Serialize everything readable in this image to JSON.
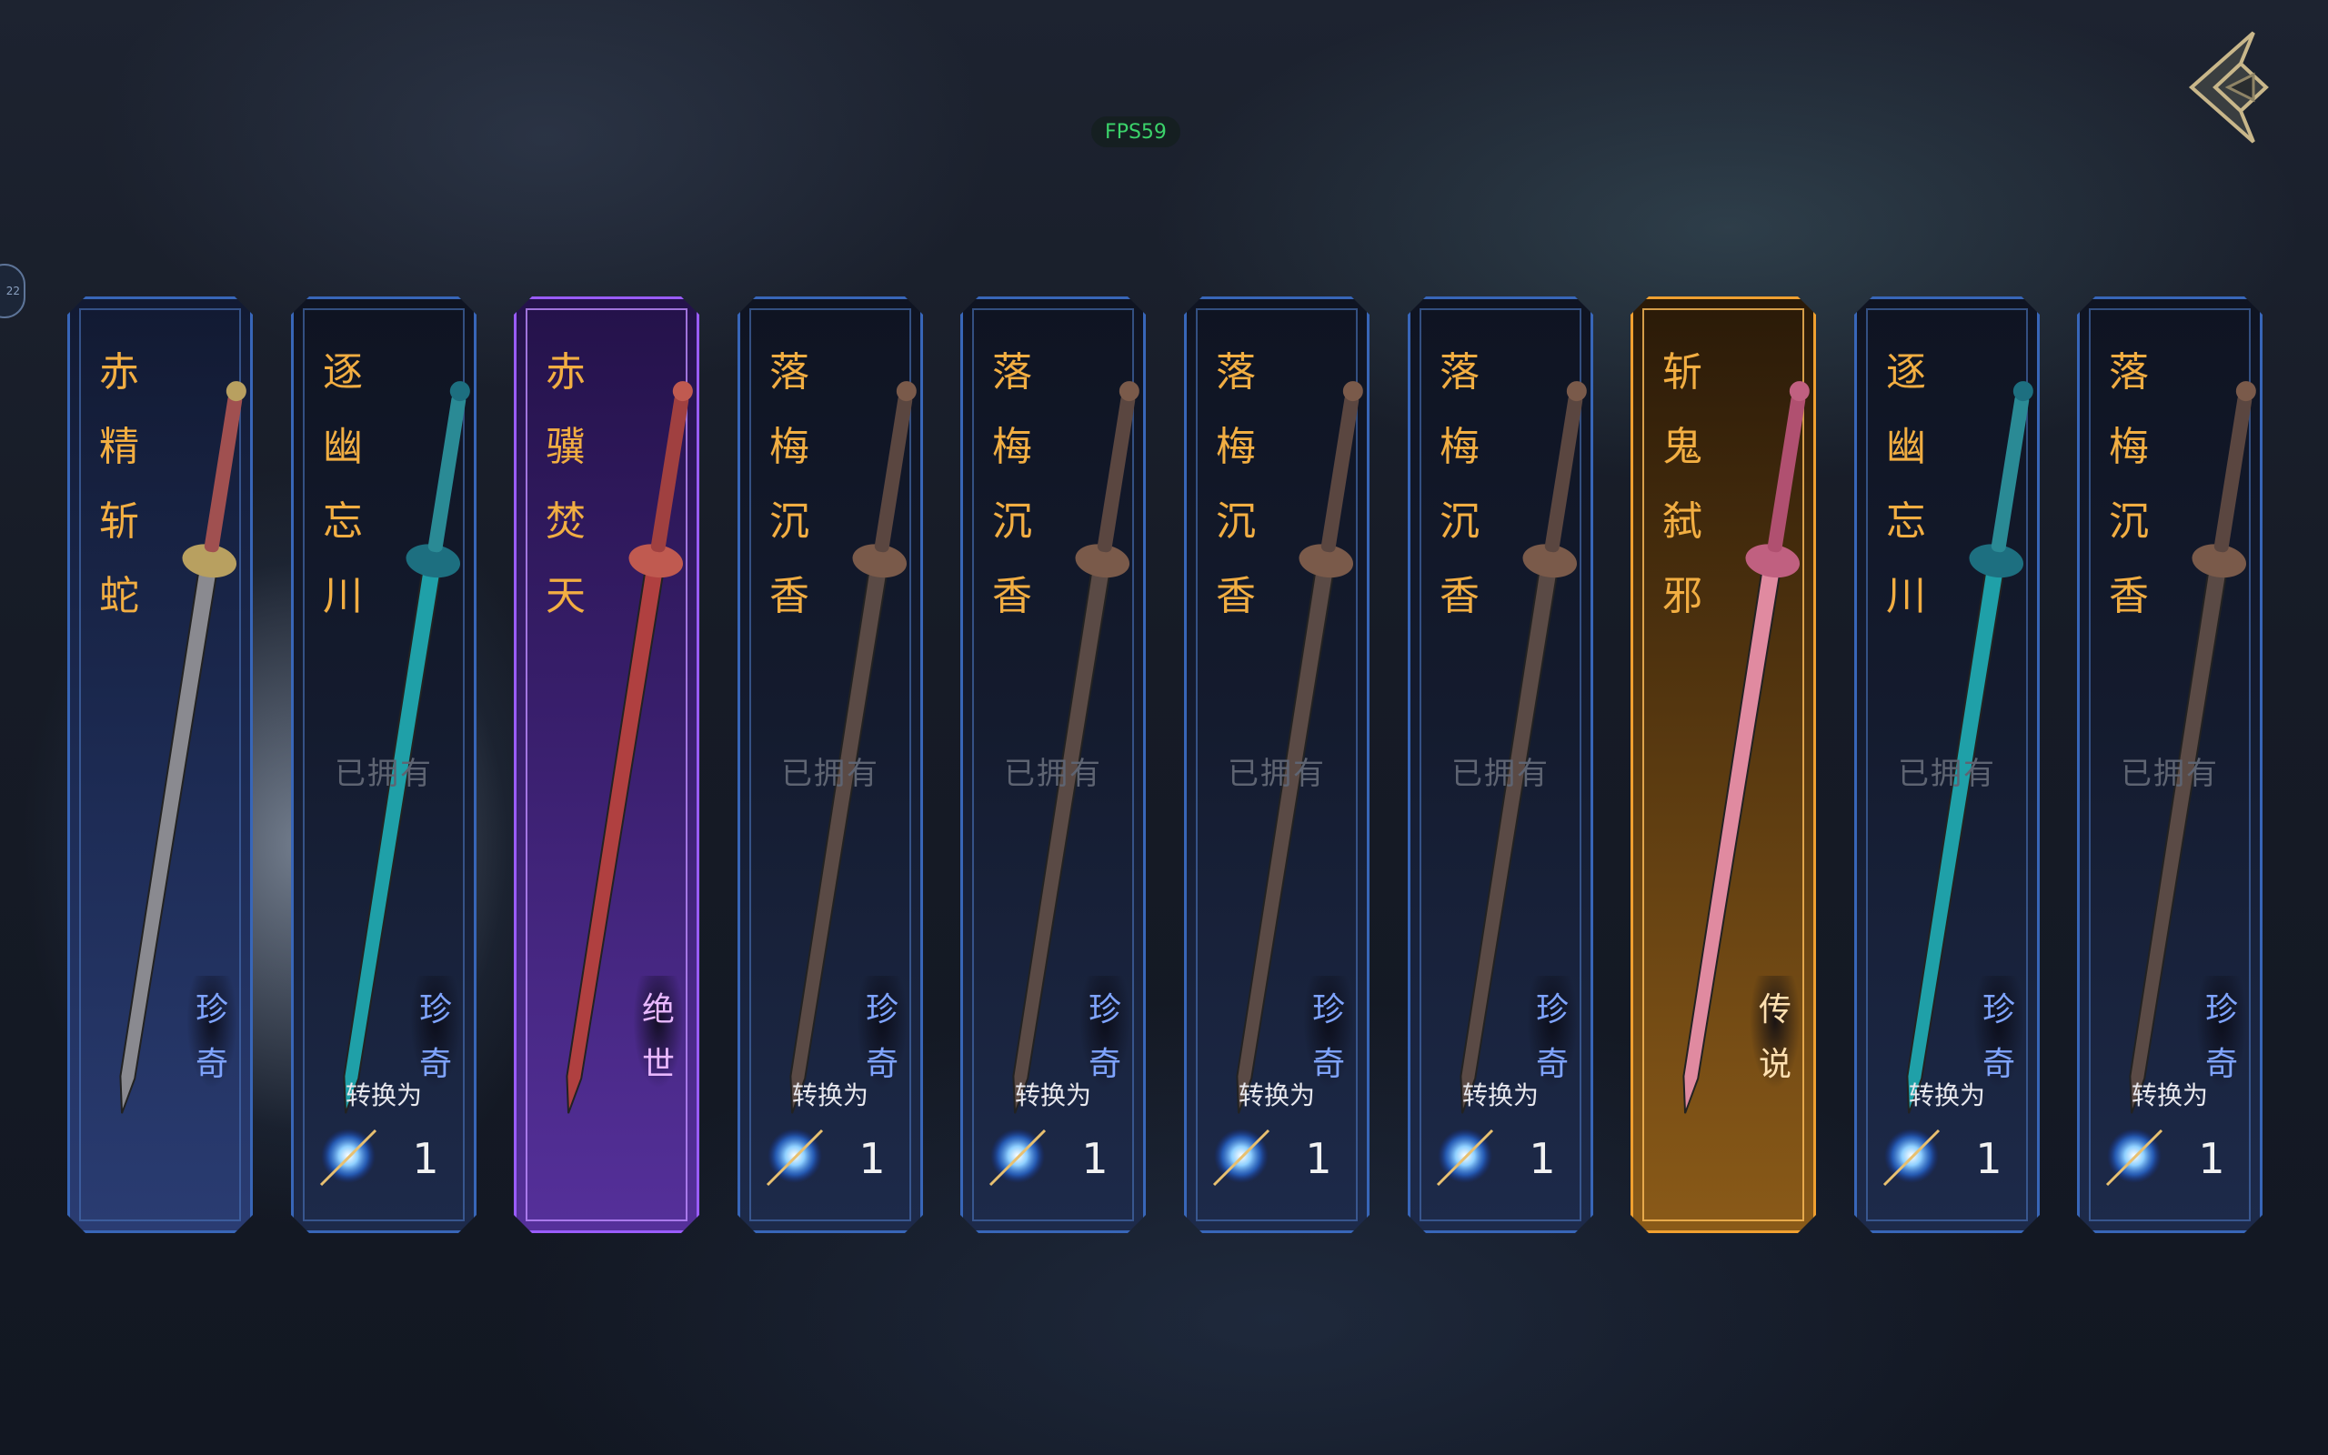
{
  "hud": {
    "fps": "FPS59",
    "side_tab": "22"
  },
  "cards": [
    {
      "name": "赤精斩蛇",
      "rarity": "珍奇",
      "rarity_level": "rare",
      "owned_label": "",
      "convert_label": "",
      "quantity": "",
      "blade": "#8a8a90",
      "hilt": "#b8a060",
      "grip": "#a05050"
    },
    {
      "name": "逐幽忘川",
      "rarity": "珍奇",
      "rarity_level": "rare",
      "owned_label": "已拥有",
      "convert_label": "转换为",
      "quantity": "1",
      "blade": "#1fa0a8",
      "hilt": "#1d6f80",
      "grip": "#2a8a95"
    },
    {
      "name": "赤骥焚天",
      "rarity": "绝世",
      "rarity_level": "epic",
      "owned_label": "",
      "convert_label": "",
      "quantity": "",
      "blade": "#b04040",
      "hilt": "#c05a50",
      "grip": "#a04040"
    },
    {
      "name": "落梅沉香",
      "rarity": "珍奇",
      "rarity_level": "rare",
      "owned_label": "已拥有",
      "convert_label": "转换为",
      "quantity": "1",
      "blade": "#5a4a45",
      "hilt": "#7a5a4a",
      "grip": "#5a4640"
    },
    {
      "name": "落梅沉香",
      "rarity": "珍奇",
      "rarity_level": "rare",
      "owned_label": "已拥有",
      "convert_label": "转换为",
      "quantity": "1",
      "blade": "#5a4a45",
      "hilt": "#7a5a4a",
      "grip": "#5a4640"
    },
    {
      "name": "落梅沉香",
      "rarity": "珍奇",
      "rarity_level": "rare",
      "owned_label": "已拥有",
      "convert_label": "转换为",
      "quantity": "1",
      "blade": "#5a4a45",
      "hilt": "#7a5a4a",
      "grip": "#5a4640"
    },
    {
      "name": "落梅沉香",
      "rarity": "珍奇",
      "rarity_level": "rare",
      "owned_label": "已拥有",
      "convert_label": "转换为",
      "quantity": "1",
      "blade": "#5a4a45",
      "hilt": "#7a5a4a",
      "grip": "#5a4640"
    },
    {
      "name": "斩鬼弑邪",
      "rarity": "传说",
      "rarity_level": "legendary",
      "owned_label": "",
      "convert_label": "",
      "quantity": "",
      "blade": "#e08aa0",
      "hilt": "#c06080",
      "grip": "#b05070"
    },
    {
      "name": "逐幽忘川",
      "rarity": "珍奇",
      "rarity_level": "rare",
      "owned_label": "已拥有",
      "convert_label": "转换为",
      "quantity": "1",
      "blade": "#1fa0a8",
      "hilt": "#1d6f80",
      "grip": "#2a8a95"
    },
    {
      "name": "落梅沉香",
      "rarity": "珍奇",
      "rarity_level": "rare",
      "owned_label": "已拥有",
      "convert_label": "转换为",
      "quantity": "1",
      "blade": "#5a4a45",
      "hilt": "#7a5a4a",
      "grip": "#5a4640"
    }
  ]
}
